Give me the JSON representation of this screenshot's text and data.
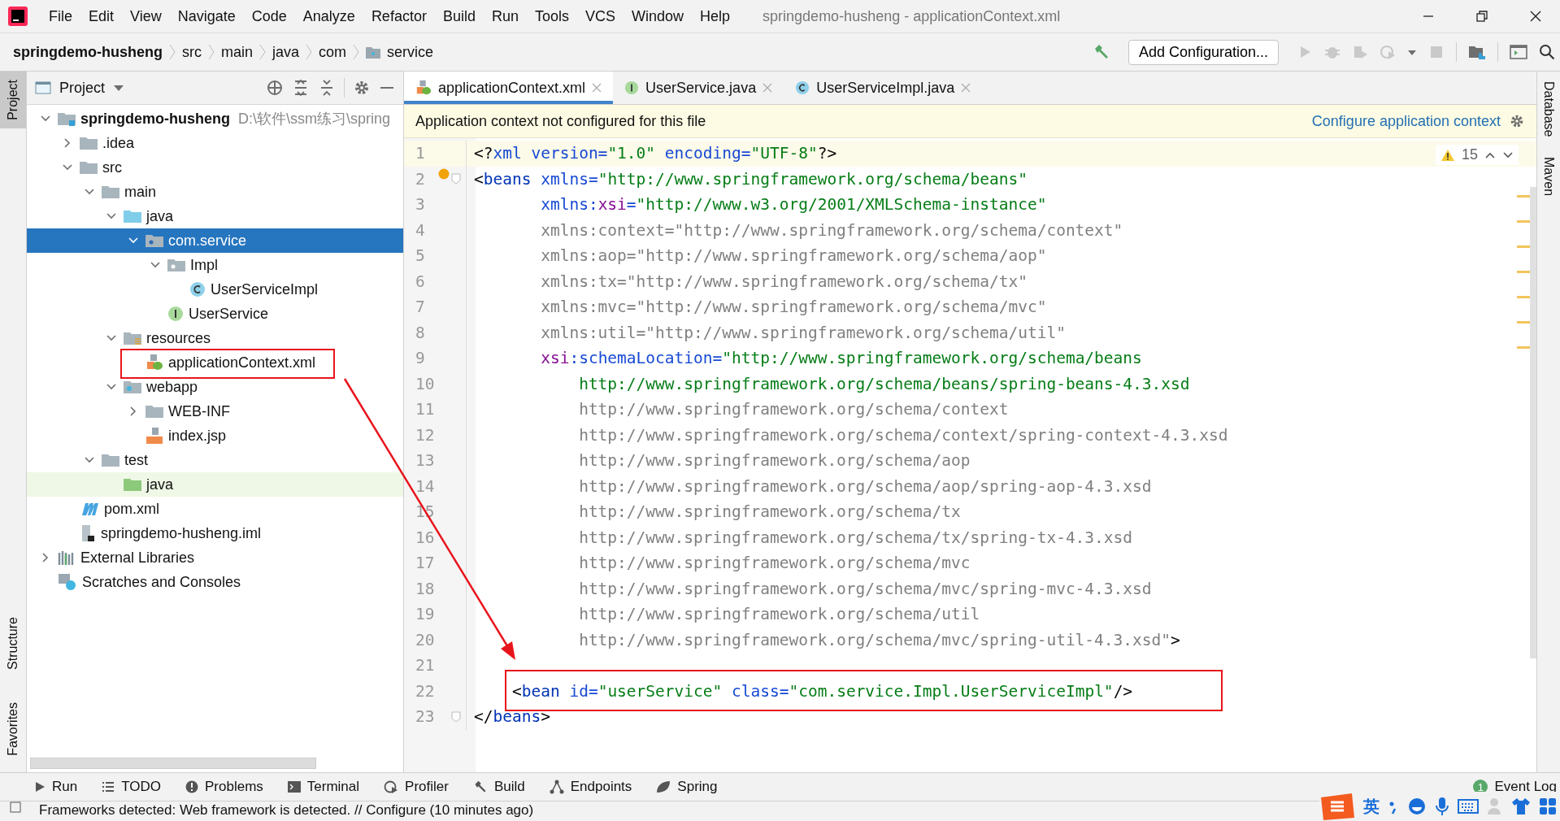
{
  "menu": [
    "File",
    "Edit",
    "View",
    "Navigate",
    "Code",
    "Analyze",
    "Refactor",
    "Build",
    "Run",
    "Tools",
    "VCS",
    "Window",
    "Help"
  ],
  "window_title": "springdemo-husheng - applicationContext.xml",
  "breadcrumbs": [
    {
      "label": "springdemo-husheng",
      "kind": "project"
    },
    {
      "label": "src",
      "kind": "plain"
    },
    {
      "label": "main",
      "kind": "plain"
    },
    {
      "label": "java",
      "kind": "plain"
    },
    {
      "label": "com",
      "kind": "plain"
    },
    {
      "label": "service",
      "kind": "folder"
    }
  ],
  "run_config": "Add Configuration...",
  "left_strip": [
    {
      "label": "Project",
      "selected": true
    },
    {
      "label": "Structure",
      "selected": false
    },
    {
      "label": "Favorites",
      "selected": false
    }
  ],
  "right_strip": [
    "Database",
    "Maven"
  ],
  "project_panel": {
    "title": "Project",
    "tree": [
      {
        "label": "springdemo-husheng",
        "path": "D:\\软件\\ssm练习\\spring",
        "kind": "module",
        "expanded": true,
        "selected": false,
        "children": [
          {
            "label": ".idea",
            "kind": "folder",
            "expanded": false,
            "selected": false
          },
          {
            "label": "src",
            "kind": "folder",
            "expanded": true,
            "selected": false,
            "children": [
              {
                "label": "main",
                "kind": "folder",
                "expanded": true,
                "selected": false,
                "children": [
                  {
                    "label": "java",
                    "kind": "source",
                    "expanded": true,
                    "selected": false,
                    "children": [
                      {
                        "label": "com.service",
                        "kind": "package",
                        "expanded": true,
                        "selected": true,
                        "children": [
                          {
                            "label": "Impl",
                            "kind": "package",
                            "expanded": true,
                            "selected": false,
                            "children": [
                              {
                                "label": "UserServiceImpl",
                                "kind": "class",
                                "selected": false
                              }
                            ]
                          },
                          {
                            "label": "UserService",
                            "kind": "interface",
                            "selected": false
                          }
                        ]
                      }
                    ]
                  },
                  {
                    "label": "resources",
                    "kind": "resources",
                    "expanded": true,
                    "selected": false,
                    "children": [
                      {
                        "label": "applicationContext.xml",
                        "kind": "xml",
                        "selected": false
                      }
                    ]
                  },
                  {
                    "label": "webapp",
                    "kind": "web",
                    "expanded": true,
                    "selected": false,
                    "children": [
                      {
                        "label": "WEB-INF",
                        "kind": "folder",
                        "expanded": false,
                        "selected": false
                      },
                      {
                        "label": "index.jsp",
                        "kind": "jsp",
                        "selected": false
                      }
                    ]
                  }
                ]
              },
              {
                "label": "test",
                "kind": "folder",
                "expanded": true,
                "selected": false,
                "children": [
                  {
                    "label": "java",
                    "kind": "test",
                    "selected": false
                  }
                ]
              }
            ]
          },
          {
            "label": "pom.xml",
            "kind": "maven",
            "selected": false
          },
          {
            "label": "springdemo-husheng.iml",
            "kind": "iml",
            "selected": false
          }
        ]
      },
      {
        "label": "External Libraries",
        "kind": "libraries",
        "expanded": false,
        "selected": false
      },
      {
        "label": "Scratches and Consoles",
        "kind": "scratches",
        "selected": false
      }
    ]
  },
  "tabs": [
    {
      "label": "applicationContext.xml",
      "kind": "xml",
      "selected": true
    },
    {
      "label": "UserService.java",
      "kind": "interface",
      "selected": false
    },
    {
      "label": "UserServiceImpl.java",
      "kind": "class",
      "selected": false
    }
  ],
  "banner": {
    "message": "Application context not configured for this file",
    "link": "Configure application context"
  },
  "editor": {
    "warnings": "15",
    "lines": [
      {
        "number": "1",
        "tokens": [
          {
            "text": "<?",
            "kind": "punct"
          },
          {
            "text": "xml version=",
            "kind": "attr"
          },
          {
            "text": "\"1.0\"",
            "kind": "value"
          },
          {
            "text": " encoding=",
            "kind": "attr"
          },
          {
            "text": "\"UTF-8\"",
            "kind": "value"
          },
          {
            "text": "?>",
            "kind": "punct"
          }
        ]
      },
      {
        "number": "2",
        "tokens": [
          {
            "text": "<",
            "kind": "punct"
          },
          {
            "text": "beans",
            "kind": "tag"
          },
          {
            "text": " xmlns=",
            "kind": "attr"
          },
          {
            "text": "\"http://www.springframework.org/schema/beans\"",
            "kind": "value"
          }
        ]
      },
      {
        "number": "3",
        "tokens": [
          {
            "text": "       xmlns:",
            "kind": "attr"
          },
          {
            "text": "xsi",
            "kind": "ns"
          },
          {
            "text": "=",
            "kind": "attr"
          },
          {
            "text": "\"http://www.w3.org/2001/XMLSchema-instance\"",
            "kind": "value"
          }
        ]
      },
      {
        "number": "4",
        "tokens": [
          {
            "text": "       xmlns:context=\"http://www.springframework.org/schema/context\"",
            "kind": "unused"
          }
        ]
      },
      {
        "number": "5",
        "tokens": [
          {
            "text": "       xmlns:aop=\"http://www.springframework.org/schema/aop\"",
            "kind": "unused"
          }
        ]
      },
      {
        "number": "6",
        "tokens": [
          {
            "text": "       xmlns:tx=\"http://www.springframework.org/schema/tx\"",
            "kind": "unused"
          }
        ]
      },
      {
        "number": "7",
        "tokens": [
          {
            "text": "       xmlns:mvc=\"http://www.springframework.org/schema/mvc\"",
            "kind": "unused"
          }
        ]
      },
      {
        "number": "8",
        "tokens": [
          {
            "text": "       xmlns:util=\"http://www.springframework.org/schema/util\"",
            "kind": "unused"
          }
        ]
      },
      {
        "number": "9",
        "tokens": [
          {
            "text": "       xsi",
            "kind": "ns"
          },
          {
            "text": ":schemaLocation=",
            "kind": "attr"
          },
          {
            "text": "\"http://www.springframework.org/schema/beans",
            "kind": "value"
          }
        ]
      },
      {
        "number": "10",
        "tokens": [
          {
            "text": "           http://www.springframework.org/schema/beans/spring-beans-4.3.xsd",
            "kind": "value"
          }
        ]
      },
      {
        "number": "11",
        "tokens": [
          {
            "text": "           http://www.springframework.org/schema/context",
            "kind": "unused"
          }
        ]
      },
      {
        "number": "12",
        "tokens": [
          {
            "text": "           http://www.springframework.org/schema/context/spring-context-4.3.xsd",
            "kind": "unused"
          }
        ]
      },
      {
        "number": "13",
        "tokens": [
          {
            "text": "           http://www.springframework.org/schema/aop",
            "kind": "unused"
          }
        ]
      },
      {
        "number": "14",
        "tokens": [
          {
            "text": "           http://www.springframework.org/schema/aop/spring-aop-4.3.xsd",
            "kind": "unused"
          }
        ]
      },
      {
        "number": "15",
        "tokens": [
          {
            "text": "           http://www.springframework.org/schema/tx",
            "kind": "unused"
          }
        ]
      },
      {
        "number": "16",
        "tokens": [
          {
            "text": "           http://www.springframework.org/schema/tx/spring-tx-4.3.xsd",
            "kind": "unused"
          }
        ]
      },
      {
        "number": "17",
        "tokens": [
          {
            "text": "           http://www.springframework.org/schema/mvc",
            "kind": "unused"
          }
        ]
      },
      {
        "number": "18",
        "tokens": [
          {
            "text": "           http://www.springframework.org/schema/mvc/spring-mvc-4.3.xsd",
            "kind": "unused"
          }
        ]
      },
      {
        "number": "19",
        "tokens": [
          {
            "text": "           http://www.springframework.org/schema/util",
            "kind": "unused"
          }
        ]
      },
      {
        "number": "20",
        "tokens": [
          {
            "text": "           http://www.springframework.org/schema/mvc/spring-util-4.3.xsd\"",
            "kind": "unused"
          },
          {
            "text": ">",
            "kind": "punct"
          }
        ]
      },
      {
        "number": "21"
      },
      {
        "number": "22",
        "tokens": [
          {
            "text": "    <",
            "kind": "punct"
          },
          {
            "text": "bean",
            "kind": "tag"
          },
          {
            "text": " id=",
            "kind": "attr"
          },
          {
            "text": "\"userService\"",
            "kind": "value"
          },
          {
            "text": " class=",
            "kind": "attr"
          },
          {
            "text": "\"com.service.Impl.UserServiceImpl\"",
            "kind": "value"
          },
          {
            "text": "/>",
            "kind": "punct"
          }
        ]
      },
      {
        "number": "23",
        "tokens": [
          {
            "text": "</",
            "kind": "punct"
          },
          {
            "text": "beans",
            "kind": "tag"
          },
          {
            "text": ">",
            "kind": "punct"
          }
        ]
      }
    ]
  },
  "tool_buttons": [
    {
      "label": "Run",
      "kind": "run"
    },
    {
      "label": "TODO",
      "kind": "todo"
    },
    {
      "label": "Problems",
      "kind": "problems"
    },
    {
      "label": "Terminal",
      "kind": "terminal"
    },
    {
      "label": "Profiler",
      "kind": "profiler"
    },
    {
      "label": "Build",
      "kind": "build"
    },
    {
      "label": "Endpoints",
      "kind": "endpoints"
    },
    {
      "label": "Spring",
      "kind": "spring"
    }
  ],
  "event_log": {
    "label": "Event Log",
    "count": "1"
  },
  "status": "Frameworks detected: Web framework is detected. // Configure (10 minutes ago)",
  "ime_mode": "英"
}
